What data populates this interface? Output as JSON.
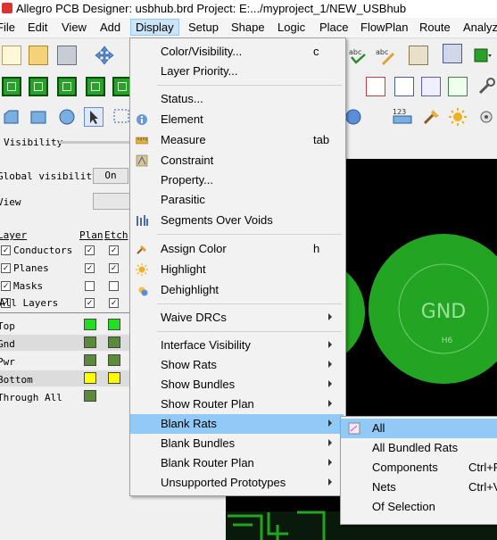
{
  "window": {
    "title": "Allegro PCB Designer: usbhub.brd  Project: E:.../myproject_1/NEW_USBhub"
  },
  "menubar": {
    "items": [
      "File",
      "Edit",
      "View",
      "Add",
      "Display",
      "Setup",
      "Shape",
      "Logic",
      "Place",
      "FlowPlan",
      "Route",
      "Analyze"
    ],
    "active": "Display"
  },
  "left_panel": {
    "header": "Visibility",
    "global_visibility_label": "Global visibility",
    "global_visibility_value": "On",
    "view_label": "View",
    "columns": {
      "layer": "Layer",
      "plan": "Plan",
      "etch": "Etch"
    },
    "categories": [
      {
        "name": "Conductors",
        "checked": true,
        "plan": true,
        "etch": true
      },
      {
        "name": "Planes",
        "checked": true,
        "plan": true,
        "etch": true
      },
      {
        "name": "Masks",
        "checked": true,
        "plan": false,
        "etch": false
      },
      {
        "name": "All Layers",
        "checked": true,
        "plan": true,
        "etch": true
      }
    ],
    "layers": [
      {
        "name": "Top",
        "plan_color": "#22dd22",
        "etch_color": "#22dd22"
      },
      {
        "name": "Gnd",
        "plan_color": "#5a8a3a",
        "etch_color": "#5a8a3a"
      },
      {
        "name": "Pwr",
        "plan_color": "#5a8a3a",
        "etch_color": "#5a8a3a"
      },
      {
        "name": "Bottom",
        "plan_color": "#ffff00",
        "etch_color": "#ffff00"
      },
      {
        "name": "Through All",
        "plan_color": "#5a8a3a",
        "etch_color": ""
      }
    ]
  },
  "canvas": {
    "pad_label": "GND",
    "pad_color": "#23a523",
    "background": "#000000"
  },
  "display_menu": {
    "items": [
      {
        "label": "Color/Visibility...",
        "shortcut": "c",
        "icon": ""
      },
      {
        "label": "Layer Priority...",
        "shortcut": "",
        "icon": ""
      },
      {
        "label": "Status...",
        "shortcut": "",
        "icon": ""
      },
      {
        "label": "Element",
        "shortcut": "",
        "icon": "info-icon"
      },
      {
        "label": "Measure",
        "shortcut": "tab",
        "icon": "ruler-icon"
      },
      {
        "label": "Constraint",
        "shortcut": "",
        "icon": "constraint-icon"
      },
      {
        "label": "Property...",
        "shortcut": "",
        "icon": ""
      },
      {
        "label": "Parasitic",
        "shortcut": "",
        "icon": ""
      },
      {
        "label": "Segments Over Voids",
        "shortcut": "",
        "icon": "segments-icon"
      },
      {
        "label": "Assign Color",
        "shortcut": "h",
        "icon": "brush-icon"
      },
      {
        "label": "Highlight",
        "shortcut": "",
        "icon": "highlight-icon"
      },
      {
        "label": "Dehighlight",
        "shortcut": "",
        "icon": "dehighlight-icon"
      },
      {
        "label": "Waive DRCs",
        "submenu": true
      },
      {
        "label": "Interface Visibility",
        "submenu": true
      },
      {
        "label": "Show Rats",
        "submenu": true
      },
      {
        "label": "Show Bundles",
        "submenu": true
      },
      {
        "label": "Show Router Plan",
        "submenu": true
      },
      {
        "label": "Blank Rats",
        "submenu": true,
        "highlighted": true
      },
      {
        "label": "Blank Bundles",
        "submenu": true
      },
      {
        "label": "Blank Router Plan",
        "submenu": true
      },
      {
        "label": "Unsupported Prototypes",
        "submenu": true
      }
    ]
  },
  "blank_rats_submenu": {
    "items": [
      {
        "label": "All",
        "shortcut": "",
        "highlighted": true,
        "icon": "blank-rats-icon"
      },
      {
        "label": "All Bundled Rats",
        "shortcut": ""
      },
      {
        "label": "Components",
        "shortcut": "Ctrl+F"
      },
      {
        "label": "Nets",
        "shortcut": "Ctrl+V"
      },
      {
        "label": "Of Selection",
        "shortcut": ""
      }
    ]
  }
}
